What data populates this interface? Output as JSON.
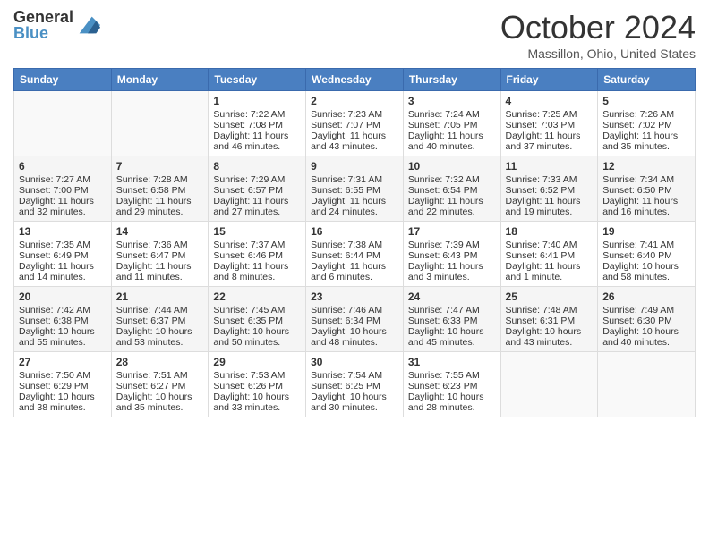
{
  "logo": {
    "general": "General",
    "blue": "Blue"
  },
  "title": "October 2024",
  "location": "Massillon, Ohio, United States",
  "days_of_week": [
    "Sunday",
    "Monday",
    "Tuesday",
    "Wednesday",
    "Thursday",
    "Friday",
    "Saturday"
  ],
  "weeks": [
    [
      {
        "day": "",
        "sunrise": "",
        "sunset": "",
        "daylight": ""
      },
      {
        "day": "",
        "sunrise": "",
        "sunset": "",
        "daylight": ""
      },
      {
        "day": "1",
        "sunrise": "Sunrise: 7:22 AM",
        "sunset": "Sunset: 7:08 PM",
        "daylight": "Daylight: 11 hours and 46 minutes."
      },
      {
        "day": "2",
        "sunrise": "Sunrise: 7:23 AM",
        "sunset": "Sunset: 7:07 PM",
        "daylight": "Daylight: 11 hours and 43 minutes."
      },
      {
        "day": "3",
        "sunrise": "Sunrise: 7:24 AM",
        "sunset": "Sunset: 7:05 PM",
        "daylight": "Daylight: 11 hours and 40 minutes."
      },
      {
        "day": "4",
        "sunrise": "Sunrise: 7:25 AM",
        "sunset": "Sunset: 7:03 PM",
        "daylight": "Daylight: 11 hours and 37 minutes."
      },
      {
        "day": "5",
        "sunrise": "Sunrise: 7:26 AM",
        "sunset": "Sunset: 7:02 PM",
        "daylight": "Daylight: 11 hours and 35 minutes."
      }
    ],
    [
      {
        "day": "6",
        "sunrise": "Sunrise: 7:27 AM",
        "sunset": "Sunset: 7:00 PM",
        "daylight": "Daylight: 11 hours and 32 minutes."
      },
      {
        "day": "7",
        "sunrise": "Sunrise: 7:28 AM",
        "sunset": "Sunset: 6:58 PM",
        "daylight": "Daylight: 11 hours and 29 minutes."
      },
      {
        "day": "8",
        "sunrise": "Sunrise: 7:29 AM",
        "sunset": "Sunset: 6:57 PM",
        "daylight": "Daylight: 11 hours and 27 minutes."
      },
      {
        "day": "9",
        "sunrise": "Sunrise: 7:31 AM",
        "sunset": "Sunset: 6:55 PM",
        "daylight": "Daylight: 11 hours and 24 minutes."
      },
      {
        "day": "10",
        "sunrise": "Sunrise: 7:32 AM",
        "sunset": "Sunset: 6:54 PM",
        "daylight": "Daylight: 11 hours and 22 minutes."
      },
      {
        "day": "11",
        "sunrise": "Sunrise: 7:33 AM",
        "sunset": "Sunset: 6:52 PM",
        "daylight": "Daylight: 11 hours and 19 minutes."
      },
      {
        "day": "12",
        "sunrise": "Sunrise: 7:34 AM",
        "sunset": "Sunset: 6:50 PM",
        "daylight": "Daylight: 11 hours and 16 minutes."
      }
    ],
    [
      {
        "day": "13",
        "sunrise": "Sunrise: 7:35 AM",
        "sunset": "Sunset: 6:49 PM",
        "daylight": "Daylight: 11 hours and 14 minutes."
      },
      {
        "day": "14",
        "sunrise": "Sunrise: 7:36 AM",
        "sunset": "Sunset: 6:47 PM",
        "daylight": "Daylight: 11 hours and 11 minutes."
      },
      {
        "day": "15",
        "sunrise": "Sunrise: 7:37 AM",
        "sunset": "Sunset: 6:46 PM",
        "daylight": "Daylight: 11 hours and 8 minutes."
      },
      {
        "day": "16",
        "sunrise": "Sunrise: 7:38 AM",
        "sunset": "Sunset: 6:44 PM",
        "daylight": "Daylight: 11 hours and 6 minutes."
      },
      {
        "day": "17",
        "sunrise": "Sunrise: 7:39 AM",
        "sunset": "Sunset: 6:43 PM",
        "daylight": "Daylight: 11 hours and 3 minutes."
      },
      {
        "day": "18",
        "sunrise": "Sunrise: 7:40 AM",
        "sunset": "Sunset: 6:41 PM",
        "daylight": "Daylight: 11 hours and 1 minute."
      },
      {
        "day": "19",
        "sunrise": "Sunrise: 7:41 AM",
        "sunset": "Sunset: 6:40 PM",
        "daylight": "Daylight: 10 hours and 58 minutes."
      }
    ],
    [
      {
        "day": "20",
        "sunrise": "Sunrise: 7:42 AM",
        "sunset": "Sunset: 6:38 PM",
        "daylight": "Daylight: 10 hours and 55 minutes."
      },
      {
        "day": "21",
        "sunrise": "Sunrise: 7:44 AM",
        "sunset": "Sunset: 6:37 PM",
        "daylight": "Daylight: 10 hours and 53 minutes."
      },
      {
        "day": "22",
        "sunrise": "Sunrise: 7:45 AM",
        "sunset": "Sunset: 6:35 PM",
        "daylight": "Daylight: 10 hours and 50 minutes."
      },
      {
        "day": "23",
        "sunrise": "Sunrise: 7:46 AM",
        "sunset": "Sunset: 6:34 PM",
        "daylight": "Daylight: 10 hours and 48 minutes."
      },
      {
        "day": "24",
        "sunrise": "Sunrise: 7:47 AM",
        "sunset": "Sunset: 6:33 PM",
        "daylight": "Daylight: 10 hours and 45 minutes."
      },
      {
        "day": "25",
        "sunrise": "Sunrise: 7:48 AM",
        "sunset": "Sunset: 6:31 PM",
        "daylight": "Daylight: 10 hours and 43 minutes."
      },
      {
        "day": "26",
        "sunrise": "Sunrise: 7:49 AM",
        "sunset": "Sunset: 6:30 PM",
        "daylight": "Daylight: 10 hours and 40 minutes."
      }
    ],
    [
      {
        "day": "27",
        "sunrise": "Sunrise: 7:50 AM",
        "sunset": "Sunset: 6:29 PM",
        "daylight": "Daylight: 10 hours and 38 minutes."
      },
      {
        "day": "28",
        "sunrise": "Sunrise: 7:51 AM",
        "sunset": "Sunset: 6:27 PM",
        "daylight": "Daylight: 10 hours and 35 minutes."
      },
      {
        "day": "29",
        "sunrise": "Sunrise: 7:53 AM",
        "sunset": "Sunset: 6:26 PM",
        "daylight": "Daylight: 10 hours and 33 minutes."
      },
      {
        "day": "30",
        "sunrise": "Sunrise: 7:54 AM",
        "sunset": "Sunset: 6:25 PM",
        "daylight": "Daylight: 10 hours and 30 minutes."
      },
      {
        "day": "31",
        "sunrise": "Sunrise: 7:55 AM",
        "sunset": "Sunset: 6:23 PM",
        "daylight": "Daylight: 10 hours and 28 minutes."
      },
      {
        "day": "",
        "sunrise": "",
        "sunset": "",
        "daylight": ""
      },
      {
        "day": "",
        "sunrise": "",
        "sunset": "",
        "daylight": ""
      }
    ]
  ]
}
